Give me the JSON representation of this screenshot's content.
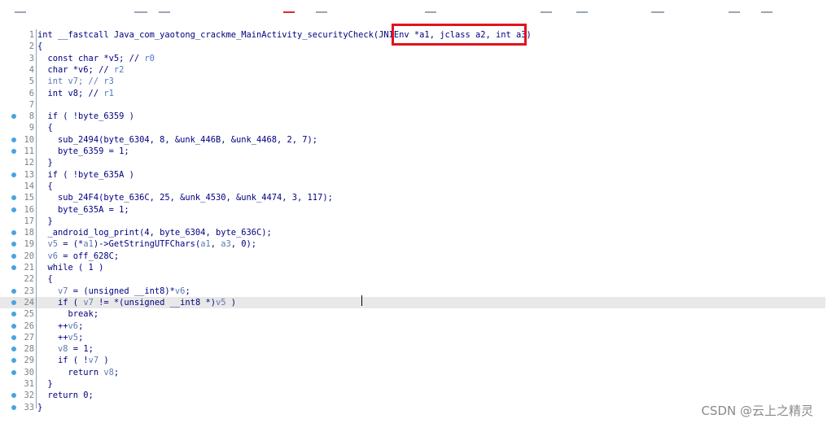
{
  "lines": [
    {
      "n": "1",
      "dot": false,
      "parts": [
        {
          "t": "int __fastcall Java_com_yaotong_crackme_MainActivity_securityCheck(JNIEnv *a1, jclass a2, int a3)",
          "c": ""
        }
      ]
    },
    {
      "n": "2",
      "dot": false,
      "parts": [
        {
          "t": "{",
          "c": ""
        }
      ]
    },
    {
      "n": "3",
      "dot": false,
      "parts": [
        {
          "t": "  const char *v5; // ",
          "c": ""
        },
        {
          "t": "r0",
          "c": "reg"
        }
      ]
    },
    {
      "n": "4",
      "dot": false,
      "parts": [
        {
          "t": "  char *v6; // ",
          "c": ""
        },
        {
          "t": "r2",
          "c": "reg"
        }
      ]
    },
    {
      "n": "5",
      "dot": false,
      "parts": [
        {
          "t": "  int v7; // ",
          "c": "var"
        },
        {
          "t": "r3",
          "c": "reg"
        }
      ]
    },
    {
      "n": "6",
      "dot": false,
      "parts": [
        {
          "t": "  int v8; // ",
          "c": ""
        },
        {
          "t": "r1",
          "c": "reg"
        }
      ]
    },
    {
      "n": "7",
      "dot": false,
      "parts": [
        {
          "t": "",
          "c": ""
        }
      ]
    },
    {
      "n": "8",
      "dot": true,
      "parts": [
        {
          "t": "  if ( !byte_6359 )",
          "c": ""
        }
      ]
    },
    {
      "n": "9",
      "dot": false,
      "parts": [
        {
          "t": "  {",
          "c": ""
        }
      ]
    },
    {
      "n": "10",
      "dot": true,
      "parts": [
        {
          "t": "    sub_2494(byte_6304, 8, &unk_446B, &unk_4468, 2, 7);",
          "c": ""
        }
      ]
    },
    {
      "n": "11",
      "dot": true,
      "parts": [
        {
          "t": "    byte_6359 = 1;",
          "c": ""
        }
      ]
    },
    {
      "n": "12",
      "dot": false,
      "parts": [
        {
          "t": "  }",
          "c": ""
        }
      ]
    },
    {
      "n": "13",
      "dot": true,
      "parts": [
        {
          "t": "  if ( !byte_635A )",
          "c": ""
        }
      ]
    },
    {
      "n": "14",
      "dot": false,
      "parts": [
        {
          "t": "  {",
          "c": ""
        }
      ]
    },
    {
      "n": "15",
      "dot": true,
      "parts": [
        {
          "t": "    sub_24F4(byte_636C, 25, &unk_4530, &unk_4474, 3, 117);",
          "c": ""
        }
      ]
    },
    {
      "n": "16",
      "dot": true,
      "parts": [
        {
          "t": "    byte_635A = 1;",
          "c": ""
        }
      ]
    },
    {
      "n": "17",
      "dot": false,
      "parts": [
        {
          "t": "  }",
          "c": ""
        }
      ]
    },
    {
      "n": "18",
      "dot": true,
      "parts": [
        {
          "t": "  _android_log_print(4, byte_6304, byte_636C);",
          "c": ""
        }
      ]
    },
    {
      "n": "19",
      "dot": true,
      "parts": [
        {
          "t": "  ",
          "c": ""
        },
        {
          "t": "v5",
          "c": "var"
        },
        {
          "t": " = (*",
          "c": ""
        },
        {
          "t": "a1",
          "c": "var"
        },
        {
          "t": ")->GetStringUTFChars(",
          "c": ""
        },
        {
          "t": "a1",
          "c": "var"
        },
        {
          "t": ", ",
          "c": ""
        },
        {
          "t": "a3",
          "c": "var"
        },
        {
          "t": ", 0);",
          "c": ""
        }
      ]
    },
    {
      "n": "20",
      "dot": true,
      "parts": [
        {
          "t": "  ",
          "c": ""
        },
        {
          "t": "v6",
          "c": "var"
        },
        {
          "t": " = off_628C;",
          "c": ""
        }
      ]
    },
    {
      "n": "21",
      "dot": true,
      "parts": [
        {
          "t": "  while ( 1 )",
          "c": ""
        }
      ]
    },
    {
      "n": "22",
      "dot": false,
      "parts": [
        {
          "t": "  {",
          "c": ""
        }
      ]
    },
    {
      "n": "23",
      "dot": true,
      "parts": [
        {
          "t": "    ",
          "c": ""
        },
        {
          "t": "v7",
          "c": "var"
        },
        {
          "t": " = (unsigned __int8)*",
          "c": ""
        },
        {
          "t": "v6",
          "c": "var"
        },
        {
          "t": ";",
          "c": ""
        }
      ]
    },
    {
      "n": "24",
      "dot": true,
      "current": true,
      "parts": [
        {
          "t": "    if ( ",
          "c": ""
        },
        {
          "t": "v7",
          "c": "var"
        },
        {
          "t": " != *(unsigned __int8 *)",
          "c": ""
        },
        {
          "t": "v5",
          "c": "var"
        },
        {
          "t": " )",
          "c": ""
        }
      ]
    },
    {
      "n": "25",
      "dot": true,
      "parts": [
        {
          "t": "      break;",
          "c": ""
        }
      ]
    },
    {
      "n": "26",
      "dot": true,
      "parts": [
        {
          "t": "    ++",
          "c": ""
        },
        {
          "t": "v6",
          "c": "var"
        },
        {
          "t": ";",
          "c": ""
        }
      ]
    },
    {
      "n": "27",
      "dot": true,
      "parts": [
        {
          "t": "    ++",
          "c": ""
        },
        {
          "t": "v5",
          "c": "var"
        },
        {
          "t": ";",
          "c": ""
        }
      ]
    },
    {
      "n": "28",
      "dot": true,
      "parts": [
        {
          "t": "    ",
          "c": ""
        },
        {
          "t": "v8",
          "c": "var"
        },
        {
          "t": " = 1;",
          "c": ""
        }
      ]
    },
    {
      "n": "29",
      "dot": true,
      "parts": [
        {
          "t": "    if ( !",
          "c": ""
        },
        {
          "t": "v7",
          "c": "var"
        },
        {
          "t": " )",
          "c": ""
        }
      ]
    },
    {
      "n": "30",
      "dot": true,
      "parts": [
        {
          "t": "      return ",
          "c": ""
        },
        {
          "t": "v8",
          "c": "var"
        },
        {
          "t": ";",
          "c": ""
        }
      ]
    },
    {
      "n": "31",
      "dot": false,
      "parts": [
        {
          "t": "  }",
          "c": ""
        }
      ]
    },
    {
      "n": "32",
      "dot": true,
      "parts": [
        {
          "t": "  return 0;",
          "c": ""
        }
      ]
    },
    {
      "n": "33",
      "dot": true,
      "parts": [
        {
          "t": "}",
          "c": ""
        }
      ]
    }
  ],
  "colors": {
    "keyword": "#000080",
    "register_comment": "#4a7ac8",
    "variable": "#5a7ab0",
    "breakpoint_dot": "#4aa3df",
    "highlight_border": "#e0141e"
  },
  "watermark": "CSDN @云上之精灵"
}
